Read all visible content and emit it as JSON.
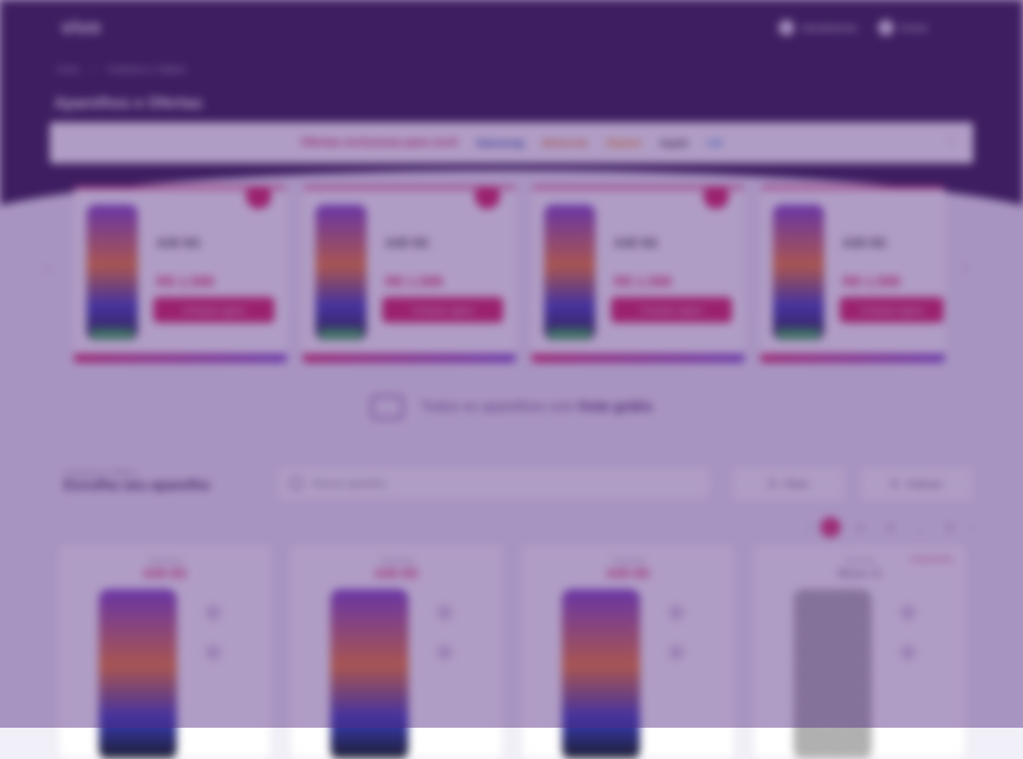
{
  "header": {
    "logo": "vivo",
    "links": [
      {
        "label": "Atendimento",
        "icon": "chat-icon"
      },
      {
        "label": "Entrar",
        "icon": "user-icon"
      }
    ]
  },
  "breadcrumb": {
    "home": "Início",
    "current": "Celulares e Tablets"
  },
  "page_title": "Aparelhos e Ofertas",
  "brand_bar": {
    "text": "Ofertas exclusivas para você",
    "brands": [
      "Samsung",
      "Motorola",
      "Xiaomi",
      "Apple",
      "LG"
    ],
    "close": "×"
  },
  "promos": [
    {
      "model": "A35 5G",
      "price": "R$ 1.599",
      "cta": "Comprar agora"
    },
    {
      "model": "A35 5G",
      "price": "R$ 1.599",
      "cta": "Comprar agora"
    },
    {
      "model": "A35 5G",
      "price": "R$ 1.599",
      "cta": "Comprar agora"
    },
    {
      "model": "A35 5G",
      "price": "R$ 1.599",
      "cta": "Comprar agora"
    }
  ],
  "shipping": {
    "prefix": "Todos os aparelhos com",
    "highlight": "frete grátis"
  },
  "list": {
    "subtitle": "Celulares e Tablets",
    "title": "Escolha seu aparelho",
    "search_placeholder": "Buscar aparelho",
    "filter_label": "Filtrar",
    "sort_label": "Ordenar"
  },
  "pager": {
    "prev": "‹",
    "pages": [
      "1",
      "2",
      "3",
      "…",
      "8"
    ],
    "next": "›"
  },
  "products": [
    {
      "condition": "Samsung",
      "name": "A35 5G",
      "tag": ""
    },
    {
      "condition": "Samsung",
      "name": "A35 5G",
      "tag": ""
    },
    {
      "condition": "Samsung",
      "name": "A35 5G",
      "tag": ""
    },
    {
      "condition": "Motorola",
      "name": "Moto G",
      "tag": "Lançamento"
    }
  ],
  "colors": {
    "brand_dark": "#2d1446",
    "accent": "#d81b60",
    "overlay": "#522a80"
  }
}
